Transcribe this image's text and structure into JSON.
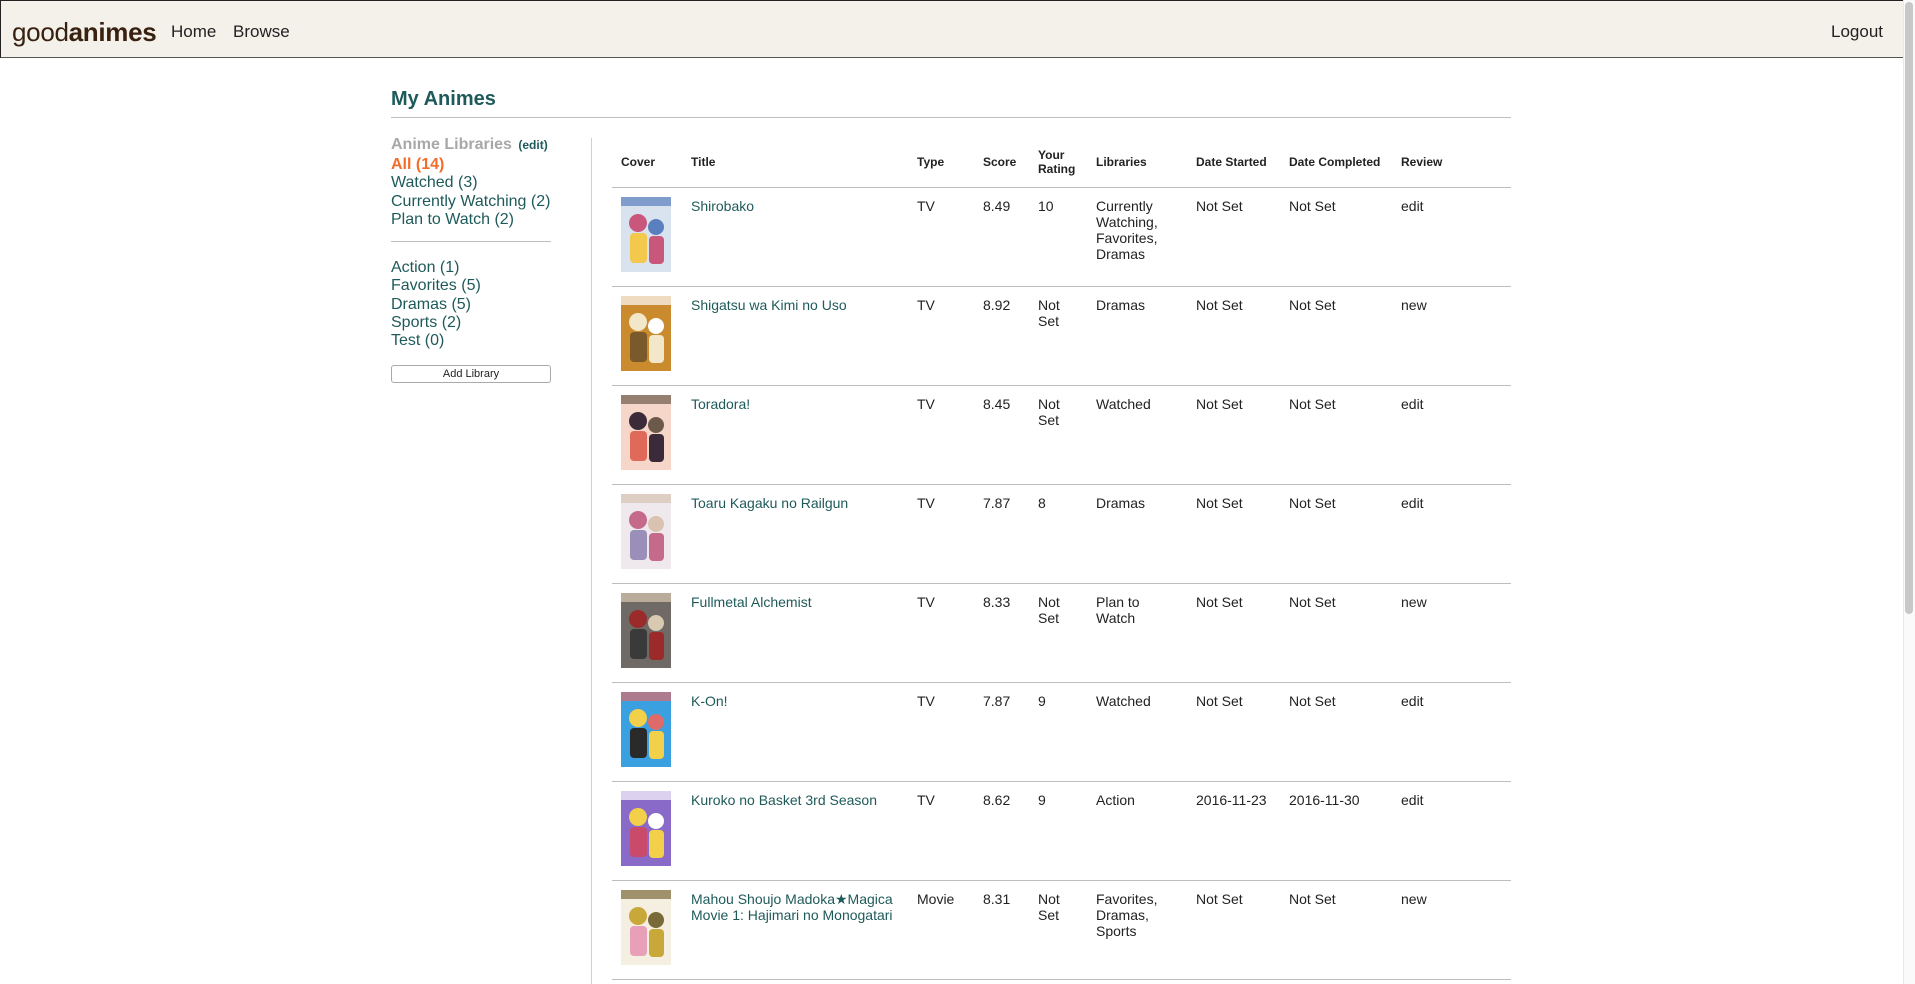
{
  "nav": {
    "brand_light": "good",
    "brand_bold": "animes",
    "home": "Home",
    "browse": "Browse",
    "logout": "Logout"
  },
  "page": {
    "title": "My Animes"
  },
  "sidebar": {
    "heading": "Anime Libraries",
    "edit": "(edit)",
    "status_libraries": [
      {
        "label": "All (14)",
        "active": true
      },
      {
        "label": "Watched (3)"
      },
      {
        "label": "Currently Watching (2)"
      },
      {
        "label": "Plan to Watch (2)"
      }
    ],
    "custom_libraries": [
      {
        "label": "Action (1)"
      },
      {
        "label": "Favorites (5)"
      },
      {
        "label": "Dramas (5)"
      },
      {
        "label": "Sports (2)"
      },
      {
        "label": "Test (0)"
      }
    ],
    "add_library": "Add Library"
  },
  "table": {
    "columns": [
      "Cover",
      "Title",
      "Type",
      "Score",
      "Your Rating",
      "Libraries",
      "Date Started",
      "Date Completed",
      "Review"
    ],
    "rows": [
      {
        "title": "Shirobako",
        "type": "TV",
        "score": "8.49",
        "rating": "10",
        "libraries": "Currently Watching, Favorites, Dramas",
        "started": "Not Set",
        "completed": "Not Set",
        "review": "edit",
        "cover_colors": [
          "#d9e2ef",
          "#c9577c",
          "#f2c94c",
          "#5a7fbf"
        ]
      },
      {
        "title": "Shigatsu wa Kimi no Uso",
        "type": "TV",
        "score": "8.92",
        "rating": "Not Set",
        "libraries": "Dramas",
        "started": "Not Set",
        "completed": "Not Set",
        "review": "new",
        "cover_colors": [
          "#c98b2e",
          "#f3e7c9",
          "#7a5a2a",
          "#ffffff"
        ]
      },
      {
        "title": "Toradora!",
        "type": "TV",
        "score": "8.45",
        "rating": "Not Set",
        "libraries": "Watched",
        "started": "Not Set",
        "completed": "Not Set",
        "review": "edit",
        "cover_colors": [
          "#f6d6c9",
          "#3a2a3a",
          "#e06a5a",
          "#6b5a4a"
        ]
      },
      {
        "title": "Toaru Kagaku no Railgun",
        "type": "TV",
        "score": "7.87",
        "rating": "8",
        "libraries": "Dramas",
        "started": "Not Set",
        "completed": "Not Set",
        "review": "edit",
        "cover_colors": [
          "#efe9ee",
          "#c56a8a",
          "#9a8fb8",
          "#d9c2b0"
        ]
      },
      {
        "title": "Fullmetal Alchemist",
        "type": "TV",
        "score": "8.33",
        "rating": "Not Set",
        "libraries": "Plan to Watch",
        "started": "Not Set",
        "completed": "Not Set",
        "review": "new",
        "cover_colors": [
          "#6f6a66",
          "#9b2a2a",
          "#3a3a3a",
          "#d8c9b0"
        ]
      },
      {
        "title": "K-On!",
        "type": "TV",
        "score": "7.87",
        "rating": "9",
        "libraries": "Watched",
        "started": "Not Set",
        "completed": "Not Set",
        "review": "edit",
        "cover_colors": [
          "#3aa0e0",
          "#f2d04a",
          "#2a2a2a",
          "#e06a6a"
        ]
      },
      {
        "title": "Kuroko no Basket 3rd Season",
        "type": "TV",
        "score": "8.62",
        "rating": "9",
        "libraries": "Action",
        "started": "2016-11-23",
        "completed": "2016-11-30",
        "review": "edit",
        "cover_colors": [
          "#8a6ac9",
          "#f2d04a",
          "#c94a6a",
          "#ffffff"
        ]
      },
      {
        "title": "Mahou Shoujo Madoka★Magica Movie 1: Hajimari no Monogatari",
        "type": "Movie",
        "score": "8.31",
        "rating": "Not Set",
        "libraries": "Favorites, Dramas, Sports",
        "started": "Not Set",
        "completed": "Not Set",
        "review": "new",
        "cover_colors": [
          "#f4efe0",
          "#c9a83a",
          "#e8a0b8",
          "#7a6a3a"
        ]
      }
    ]
  }
}
